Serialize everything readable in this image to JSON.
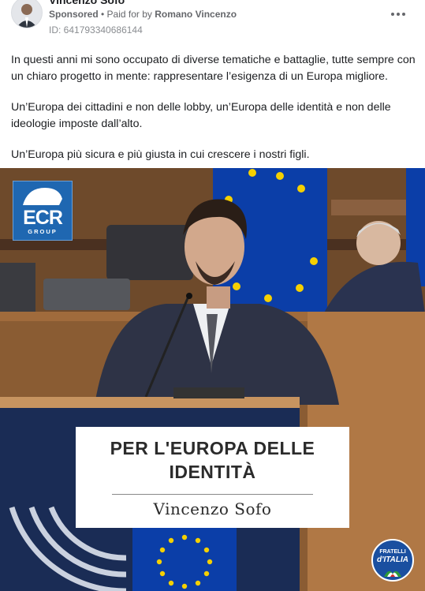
{
  "header": {
    "page_name": "Vincenzo Sofo",
    "sponsored_label": "Sponsored",
    "separator": " • ",
    "paid_for_prefix": "Paid for by ",
    "payer_name": "Romano Vincenzo",
    "ad_id": "ID: 641793340686144",
    "more_icon": "more-horizontal-icon"
  },
  "post": {
    "paragraphs": [
      "In questi anni mi sono occupato di diverse tematiche e battaglie, tutte sempre con un chiaro progetto in mente: rappresentare l’esigenza di un Europa migliore.",
      "Un’Europa dei cittadini e non delle lobby, un’Europa delle identità e non delle ideologie imposte dall’alto.",
      "Un’Europa più sicura e più giusta in cui crescere i nostri figli."
    ]
  },
  "image": {
    "ecr_logo": {
      "main": "ECR",
      "sub": "GROUP"
    },
    "caption": {
      "title": "PER L'EUROPA DELLE\nIDENTITÀ",
      "name": "Vincenzo Sofo"
    },
    "party_logo": {
      "line1": "FRATELLI",
      "line2": "d'ITALIA"
    },
    "colors": {
      "eu_blue": "#0b3ea8",
      "eu_star": "#f5d000",
      "wood": "#7a5230",
      "ecr_blue": "#1f67b1",
      "fdi_blue": "#1a4fa0"
    }
  }
}
